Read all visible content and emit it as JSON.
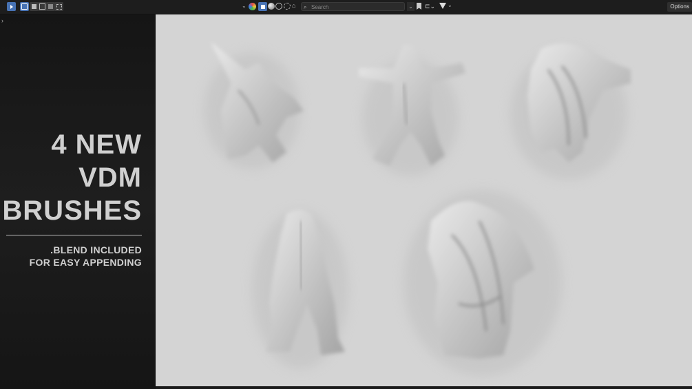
{
  "toolbar": {
    "search_placeholder": "Search",
    "options_label": "Options"
  },
  "panel": {
    "title_lines": [
      "4 NEW",
      "VDM",
      "BRUSHES"
    ],
    "subtitle_lines": [
      ".BLEND INCLUDED",
      "FOR EASY APPENDING"
    ]
  },
  "colors": {
    "viewport_bg": "#d4d4d4",
    "panel_bg": "#1a1a1a",
    "accent": "#4772b3"
  },
  "icons": [
    "select-tool-icon",
    "mode-new-icon",
    "mode-add-icon",
    "mode-subtract-icon",
    "mode-invert-icon",
    "mode-intersect-icon",
    "shading-dropdown-icon",
    "material-icon",
    "solid-icon",
    "viewport-shading-icon",
    "link-icon",
    "rendered-icon",
    "outliner-filter-icon",
    "search-icon",
    "bookmark-icon",
    "hierarchy-icon",
    "filter-icon",
    "chevron-right-icon"
  ]
}
